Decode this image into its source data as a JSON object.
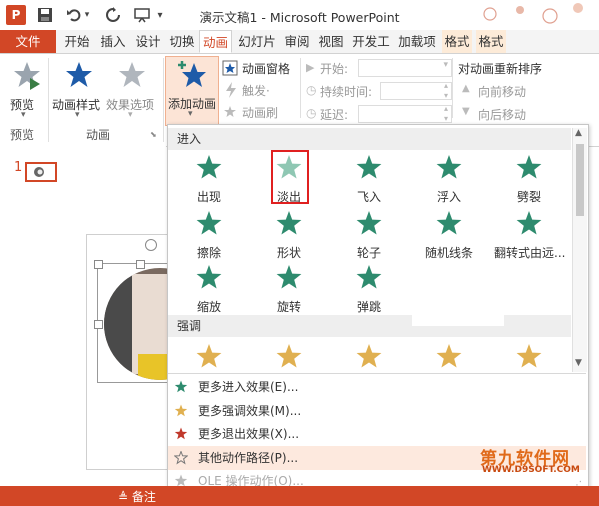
{
  "window": {
    "title": "演示文稿1 - Microsoft PowerPoint"
  },
  "tabs": {
    "file": "文件",
    "home": "开始",
    "insert": "插入",
    "design": "设计",
    "transitions": "切换",
    "animations": "动画",
    "slideshow": "幻灯片",
    "review": "审阅",
    "view": "视图",
    "developer": "开发工",
    "addins": "加载项",
    "format1": "格式",
    "format2": "格式"
  },
  "ribbon": {
    "preview": "预览",
    "preview_group": "预览",
    "anim_styles": "动画样式",
    "effect_options": "效果选项",
    "anim_group": "动画",
    "add_anim": "添加动画",
    "anim_pane": "动画窗格",
    "trigger": "触发·",
    "anim_painter": "动画刷",
    "start": "开始:",
    "duration": "持续时间:",
    "delay": "延迟:",
    "reorder": "对动画重新排序",
    "move_earlier": "向前移动",
    "move_later": "向后移动"
  },
  "slides": {
    "number": "1"
  },
  "dropdown": {
    "entrance_header": "进入",
    "entrance": [
      {
        "label": "出现",
        "icon": "appear-star-icon"
      },
      {
        "label": "淡出",
        "icon": "fade-star-icon"
      },
      {
        "label": "飞入",
        "icon": "fly-in-star-icon"
      },
      {
        "label": "浮入",
        "icon": "float-in-star-icon"
      },
      {
        "label": "劈裂",
        "icon": "split-star-icon"
      },
      {
        "label": "擦除",
        "icon": "wipe-star-icon"
      },
      {
        "label": "形状",
        "icon": "shape-star-icon"
      },
      {
        "label": "轮子",
        "icon": "wheel-star-icon"
      },
      {
        "label": "随机线条",
        "icon": "random-bars-star-icon"
      },
      {
        "label": "翻转式由远...",
        "icon": "grow-turn-star-icon"
      },
      {
        "label": "缩放",
        "icon": "zoom-star-icon"
      },
      {
        "label": "旋转",
        "icon": "swivel-star-icon"
      },
      {
        "label": "弹跳",
        "icon": "bounce-star-icon"
      }
    ],
    "emphasis_header": "强调",
    "menu": [
      {
        "label": "更多进入效果(E)...",
        "color": "#2e8b6e"
      },
      {
        "label": "更多强调效果(M)...",
        "color": "#e0b050"
      },
      {
        "label": "更多退出效果(X)...",
        "color": "#c0392b"
      },
      {
        "label": "其他动作路径(P)...",
        "color": "#777777"
      },
      {
        "label": "OLE 操作动作(O)...",
        "color": "#bbbbbb"
      }
    ]
  },
  "statusbar": {
    "notes": "备注"
  },
  "watermark": {
    "name": "第九软件网",
    "url": "WWW.D9SOFT.COM"
  },
  "colors": {
    "accent": "#d24726",
    "entrance": "#2e8b6e",
    "emphasis": "#e0b050",
    "ribbon_star": "#8f9aa6"
  }
}
